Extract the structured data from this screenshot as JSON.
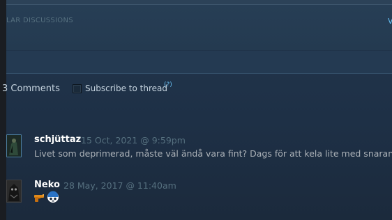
{
  "discussions": {
    "title": "LAR DISCUSSIONS",
    "view_all": "V"
  },
  "comments_section": {
    "count_prefix": "3",
    "count_label": "Comments",
    "subscribe_label": "Subscribe to thread",
    "help_label": "(?)"
  },
  "comments": [
    {
      "author": "schjüttaz",
      "timestamp": "15 Oct, 2021 @ 9:59pm",
      "text": "Livet som deprimerad, måste väl ändå vara fint? Dags för att kela lite med snaran",
      "avatar": "avatar-dark-figure"
    },
    {
      "author": "Neko",
      "timestamp": "28 May, 2017 @ 11:40am",
      "text": "",
      "emotes": [
        "pistol-emote",
        "skull-helmet-emote"
      ],
      "avatar": "avatar-dark-creature"
    }
  ]
}
